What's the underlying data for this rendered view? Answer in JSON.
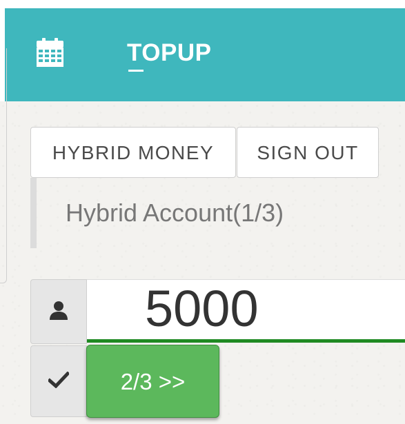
{
  "header": {
    "title": "TOPUP",
    "icon": "calendar-icon",
    "background_color": "#3fb7bd"
  },
  "toolbar": {
    "hybrid_money_label": "HYBRID MONEY",
    "sign_out_label": "SIGN OUT"
  },
  "account": {
    "label": "Hybrid Account(1/3)"
  },
  "form": {
    "amount_icon": "user-icon",
    "amount_value": "5000",
    "step_icon": "check-icon",
    "next_label": "2/3 >>",
    "next_color": "#5cb85c",
    "underline_color": "#1f8a22"
  }
}
